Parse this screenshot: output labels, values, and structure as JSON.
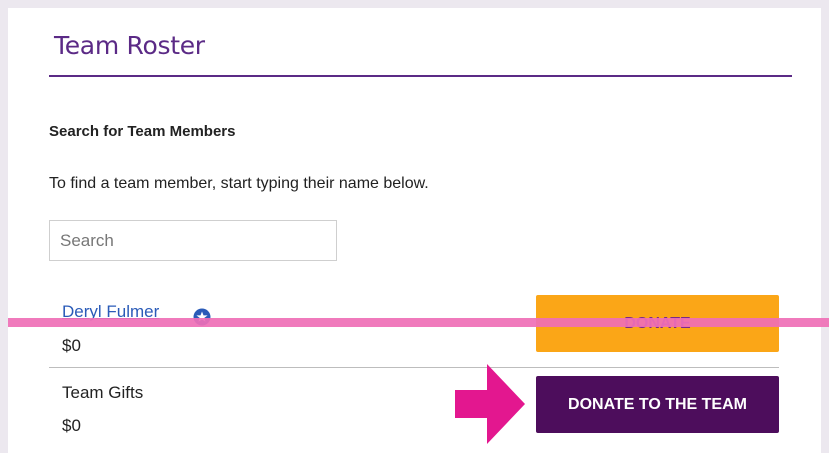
{
  "header": {
    "title": "Team Roster"
  },
  "search": {
    "heading": "Search for Team Members",
    "instructions": "To find a team member, start typing their name below.",
    "placeholder": "Search"
  },
  "members": [
    {
      "name": "Deryl Fulmer",
      "amount": "$0",
      "donate_label": "DONATE"
    }
  ],
  "team_gifts": {
    "label": "Team Gifts",
    "amount": "$0",
    "donate_label": "DONATE TO THE TEAM"
  },
  "colors": {
    "accent": "#5b2a86",
    "donate": "#fba617",
    "donate_team": "#4d0d5c",
    "overlay": "#ef6fb6"
  },
  "icons": {
    "member_badge": "star-badge-icon",
    "overlay_arrow": "arrow-right-icon"
  }
}
